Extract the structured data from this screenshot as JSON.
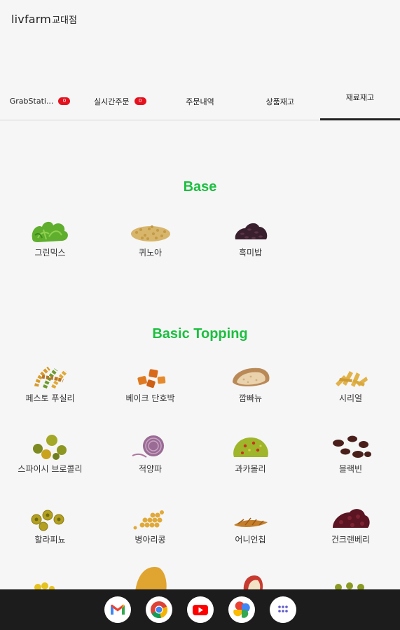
{
  "header": {
    "brand": "livfarm",
    "store": "교대점"
  },
  "tabs": [
    {
      "label": "GrabStati...",
      "badge": "0"
    },
    {
      "label": "실시간주문",
      "badge": "0"
    },
    {
      "label": "주문내역"
    },
    {
      "label": "상품재고"
    },
    {
      "label": "재료재고",
      "active": true
    }
  ],
  "sections": {
    "base": {
      "title": "Base",
      "items": [
        {
          "label": "그린믹스",
          "icon": "greens-icon"
        },
        {
          "label": "퀴노아",
          "icon": "quinoa-icon"
        },
        {
          "label": "흑미밥",
          "icon": "black-rice-icon"
        }
      ]
    },
    "basic_topping": {
      "title": "Basic Topping",
      "items": [
        {
          "label": "페스토 푸실리",
          "icon": "fusilli-icon"
        },
        {
          "label": "베이크 단호박",
          "icon": "pumpkin-icon"
        },
        {
          "label": "깜빠뉴",
          "icon": "bread-icon"
        },
        {
          "label": "시리얼",
          "icon": "cereal-icon"
        },
        {
          "label": "스파이시 브로콜리",
          "icon": "broccoli-icon"
        },
        {
          "label": "적양파",
          "icon": "red-onion-icon"
        },
        {
          "label": "과카몰리",
          "icon": "guacamole-icon"
        },
        {
          "label": "블랙빈",
          "icon": "black-bean-icon"
        },
        {
          "label": "할라피뇨",
          "icon": "jalapeno-icon"
        },
        {
          "label": "병아리콩",
          "icon": "chickpea-icon"
        },
        {
          "label": "어니언칩",
          "icon": "onion-chip-icon"
        },
        {
          "label": "건크랜베리",
          "icon": "cranberry-icon"
        }
      ]
    }
  },
  "dock": [
    {
      "name": "gmail-icon"
    },
    {
      "name": "chrome-icon"
    },
    {
      "name": "youtube-icon"
    },
    {
      "name": "photos-icon"
    },
    {
      "name": "app-drawer-icon"
    }
  ],
  "colors": {
    "section_title": "#1bbf3f",
    "badge": "#e5121e",
    "active_tab_indicator": "#222222",
    "dock": "#1c1c1c"
  }
}
